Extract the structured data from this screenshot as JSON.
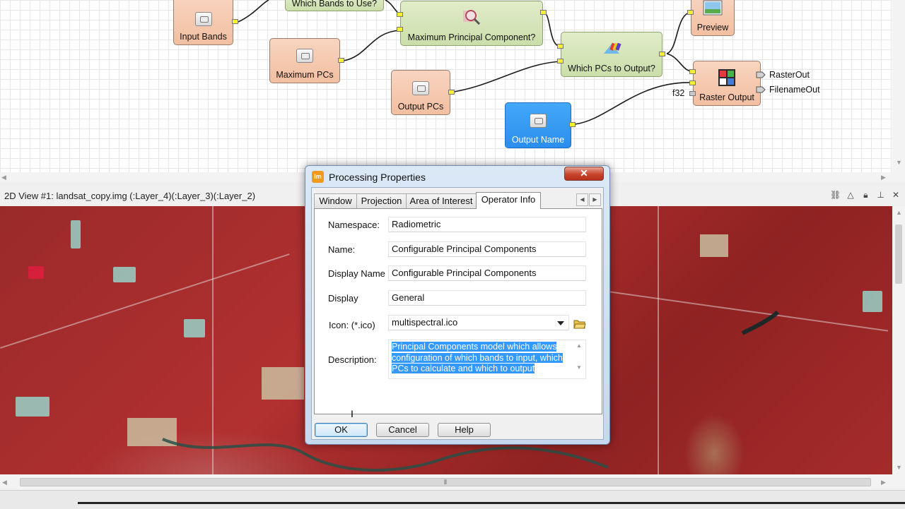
{
  "model": {
    "nodes": {
      "input_bands": "Input Bands",
      "which_bands": "Which Bands to Use?",
      "maximum_pcs": "Maximum PCs",
      "max_principal": "Maximum Principal Component?",
      "output_pcs": "Output PCs",
      "which_pcs": "Which PCs to Output?",
      "output_name": "Output Name",
      "preview": "Preview",
      "raster_output": "Raster Output"
    },
    "ports": {
      "raster_out": "RasterOut",
      "filename_out": "FilenameOut",
      "f32": "f32"
    }
  },
  "view": {
    "title": "2D View #1: landsat_copy.img (:Layer_4)(:Layer_3)(:Layer_2)",
    "tools": [
      "link-icon",
      "warning-icon",
      "lock-icon",
      "pin-icon",
      "close-icon"
    ]
  },
  "dialog": {
    "title": "Processing Properties",
    "close_label": "✕",
    "tabs": [
      "Window",
      "Projection",
      "Area of Interest",
      "Operator Info"
    ],
    "active_tab": "Operator Info",
    "fields": {
      "namespace": {
        "label": "Namespace:",
        "value": "Radiometric"
      },
      "name": {
        "label": "Name:",
        "value": "Configurable Principal Components"
      },
      "display_name": {
        "label": "Display Name",
        "value": "Configurable Principal Components"
      },
      "display": {
        "label": "Display",
        "value": "General"
      },
      "icon": {
        "label": "Icon: (*.ico)",
        "value": "multispectral.ico"
      },
      "description": {
        "label": "Description:",
        "value": "Principal Components model which allows configuration of which bands to input, which PCs to calculate and which to output"
      }
    },
    "buttons": {
      "ok": "OK",
      "cancel": "Cancel",
      "help": "Help"
    }
  },
  "colors": {
    "input_node": "#f2bfa1",
    "operator_node": "#cadeaa",
    "selected_node": "#2b8ef0",
    "port": "#f6f033",
    "selection": "#3399ff",
    "close_button": "#c8432c"
  }
}
